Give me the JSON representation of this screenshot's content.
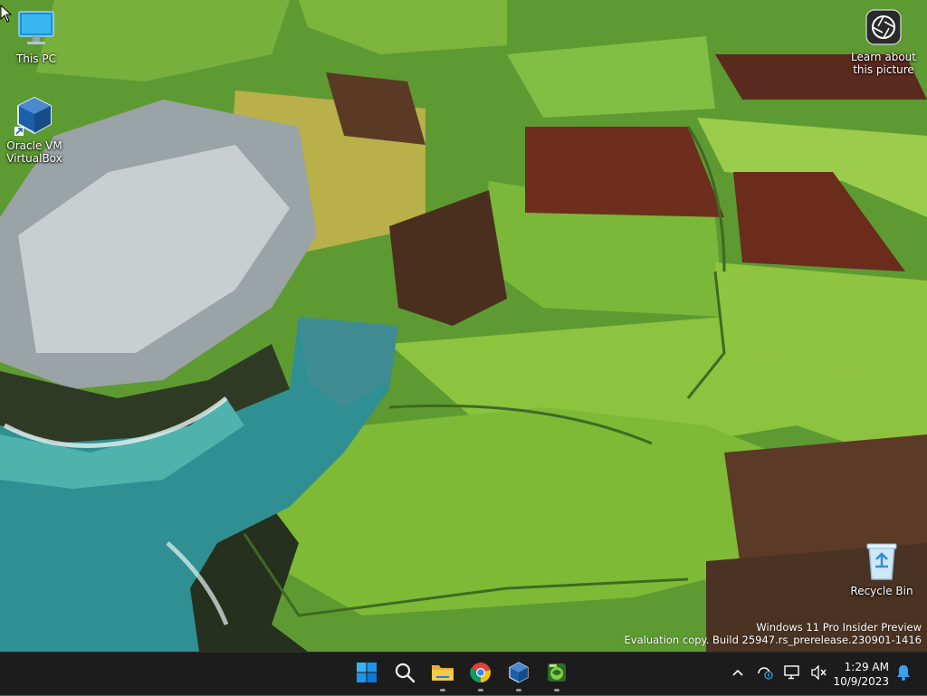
{
  "desktop": {
    "icons": [
      {
        "label": "This PC",
        "icon": "monitor-icon"
      },
      {
        "label": "Oracle VM\nVirtualBox",
        "icon": "virtualbox-icon"
      },
      {
        "label": "Recycle Bin",
        "icon": "recycle-bin-icon"
      }
    ],
    "learn_about": {
      "label_line1": "Learn about",
      "label_line2": "this picture",
      "icon": "camera-icon"
    },
    "watermark": {
      "line1": "Windows 11 Pro Insider Preview",
      "line2": "Evaluation copy. Build 25947.rs_prerelease.230901-1416"
    }
  },
  "taskbar": {
    "pinned": [
      {
        "name": "start",
        "icon": "windows-logo-icon",
        "running": false
      },
      {
        "name": "search",
        "icon": "search-icon",
        "running": false
      },
      {
        "name": "file-explorer",
        "icon": "folder-icon",
        "running": true
      },
      {
        "name": "chrome",
        "icon": "chrome-icon",
        "running": true
      },
      {
        "name": "virtualbox",
        "icon": "virtualbox-icon",
        "running": true
      },
      {
        "name": "app",
        "icon": "app-icon",
        "running": true
      }
    ],
    "tray": {
      "overflow_icon": "chevron-up-icon",
      "network_icon": "network-icon",
      "display_icon": "display-icon",
      "volume_icon": "volume-muted-icon"
    },
    "clock": {
      "time": "1:29 AM",
      "date": "10/9/2023"
    },
    "notification_icon": "bell-icon"
  },
  "colors": {
    "taskbar_bg": "#1c1c1c",
    "accent_blue": "#0078d4",
    "folder_yellow": "#f4c542"
  }
}
